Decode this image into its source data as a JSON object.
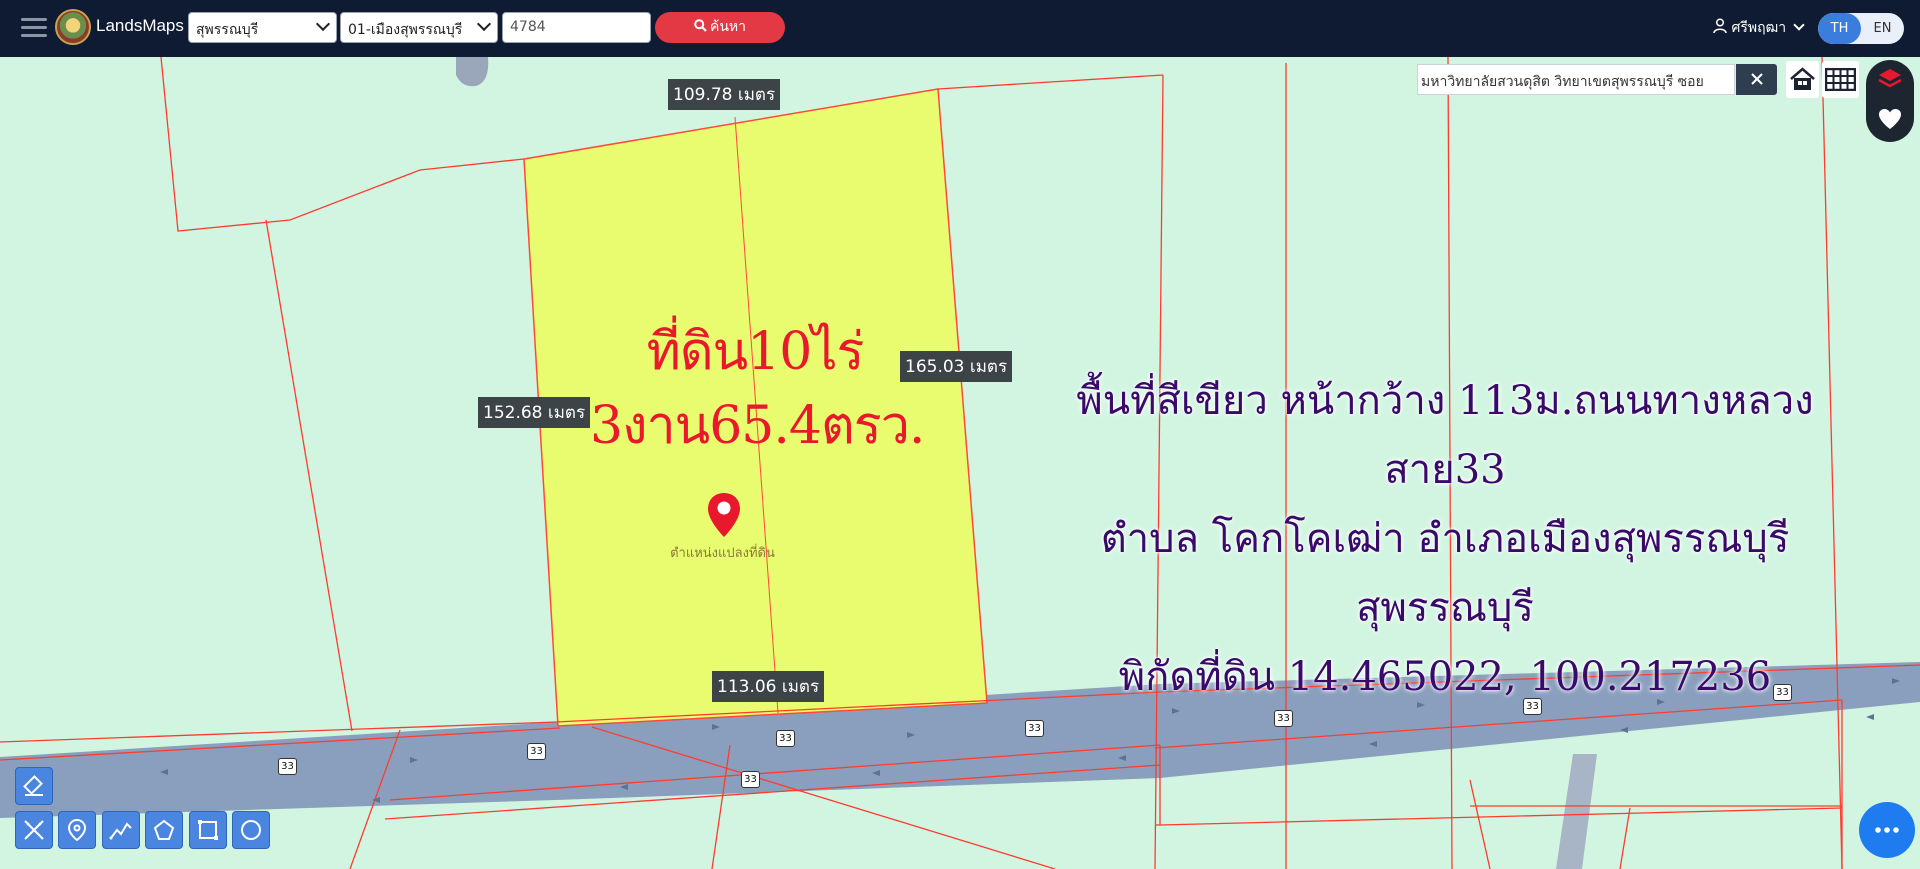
{
  "app": {
    "name": "LandsMaps"
  },
  "search_bar": {
    "province": "สุพรรณบุรี",
    "district": "01-เมืองสุพรรณบุรี",
    "parcel_no": "4784",
    "search_label": "ค้นหา"
  },
  "user": {
    "name": "ศรีพฤฒา"
  },
  "language": {
    "th": "TH",
    "en": "EN",
    "active": "TH"
  },
  "place_search": {
    "value": "มหาวิทยาลัยสวนดุสิต วิทยาเขตสุพรรณบุรี ซอย"
  },
  "map": {
    "parcel": {
      "title_line1": "ที่ดิน10ไร่",
      "title_line2": "3งาน65.4ตรว.",
      "marker_label": "ตำแหน่งแปลงที่ดิน"
    },
    "dimensions": {
      "top": "109.78 เมตร",
      "right": "165.03 เมตร",
      "left": "152.68 เมตร",
      "bottom": "113.06 เมตร"
    },
    "info_lines": [
      "พื้นที่สีเขียว หน้ากว้าง 113ม.ถนนทางหลวงสาย33",
      "ตำบล โคกโคเฒ่า อำเภอเมืองสุพรรณบุรี สุพรรณบุรี",
      "พิกัดที่ดิน 14.465022, 100.217236"
    ],
    "highway_shields": [
      "33",
      "33",
      "33",
      "33",
      "33",
      "33",
      "33",
      "33"
    ]
  },
  "colors": {
    "topbar": "#0e1b33",
    "search_button": "#e23945",
    "map_background": "#d2f5e1",
    "parcel_fill": "#e9fb6e",
    "parcel_border": "#ff3b30",
    "road": "#8a9fbd",
    "title_red": "#e8192c",
    "info_purple": "#3a0a6b",
    "tool_blue": "#4a86e0",
    "fab_blue": "#1f7cf0"
  },
  "icons": {
    "menu": "hamburger-icon",
    "search": "search-icon",
    "user": "user-icon",
    "home": "home-icon",
    "grid": "grid-icon",
    "layers": "layers-icon",
    "favorite": "heart-icon",
    "marker": "map-pin-icon",
    "more": "more-dots-icon"
  }
}
